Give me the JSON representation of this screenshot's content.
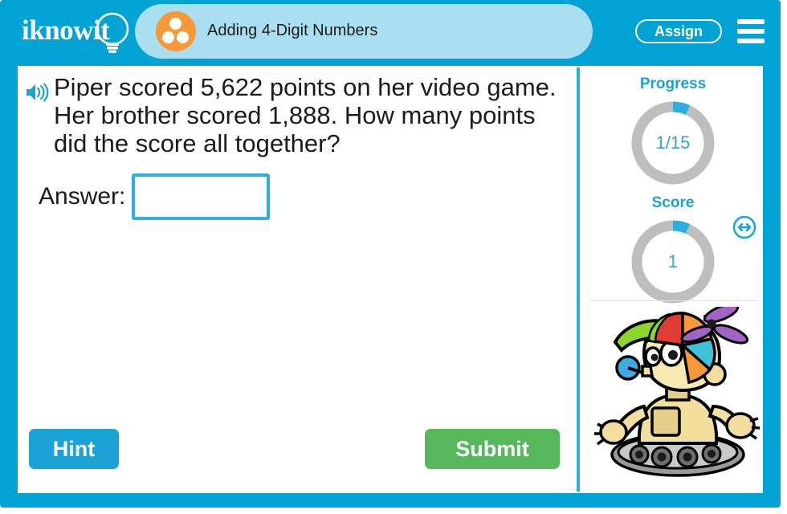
{
  "header": {
    "logo_text": "iknowit",
    "logo_icon": "lightbulb-icon",
    "lesson_icon": "three-dots-circle-icon",
    "lesson_title": "Adding 4-Digit Numbers",
    "assign_label": "Assign",
    "menu_icon": "hamburger-menu-icon"
  },
  "question": {
    "speaker_icon": "speaker-audio-icon",
    "text": "Piper scored 5,622 points on her video game. Her brother scored 1,888. How many points did the score all together?",
    "answer_label": "Answer:",
    "answer_value": "",
    "answer_placeholder": ""
  },
  "actions": {
    "hint_label": "Hint",
    "submit_label": "Submit"
  },
  "sidebar": {
    "progress": {
      "label": "Progress",
      "value": "1/15",
      "current": 1,
      "total": 15,
      "percent": 6.7
    },
    "score": {
      "label": "Score",
      "value": "1",
      "current": 1,
      "percent": 6.7
    },
    "mascot_icon": "robot-mascot-propeller-hat",
    "fullscreen_icon": "resize-horizontal-arrows-icon"
  },
  "colors": {
    "frame_blue": "#00A3D3",
    "tab_blue": "#A9DFF0",
    "accent_cyan": "#2AAFE0",
    "meter_track_gray": "#BEBEBE",
    "submit_green": "#57B75B",
    "lesson_icon_orange": "#F79839"
  }
}
